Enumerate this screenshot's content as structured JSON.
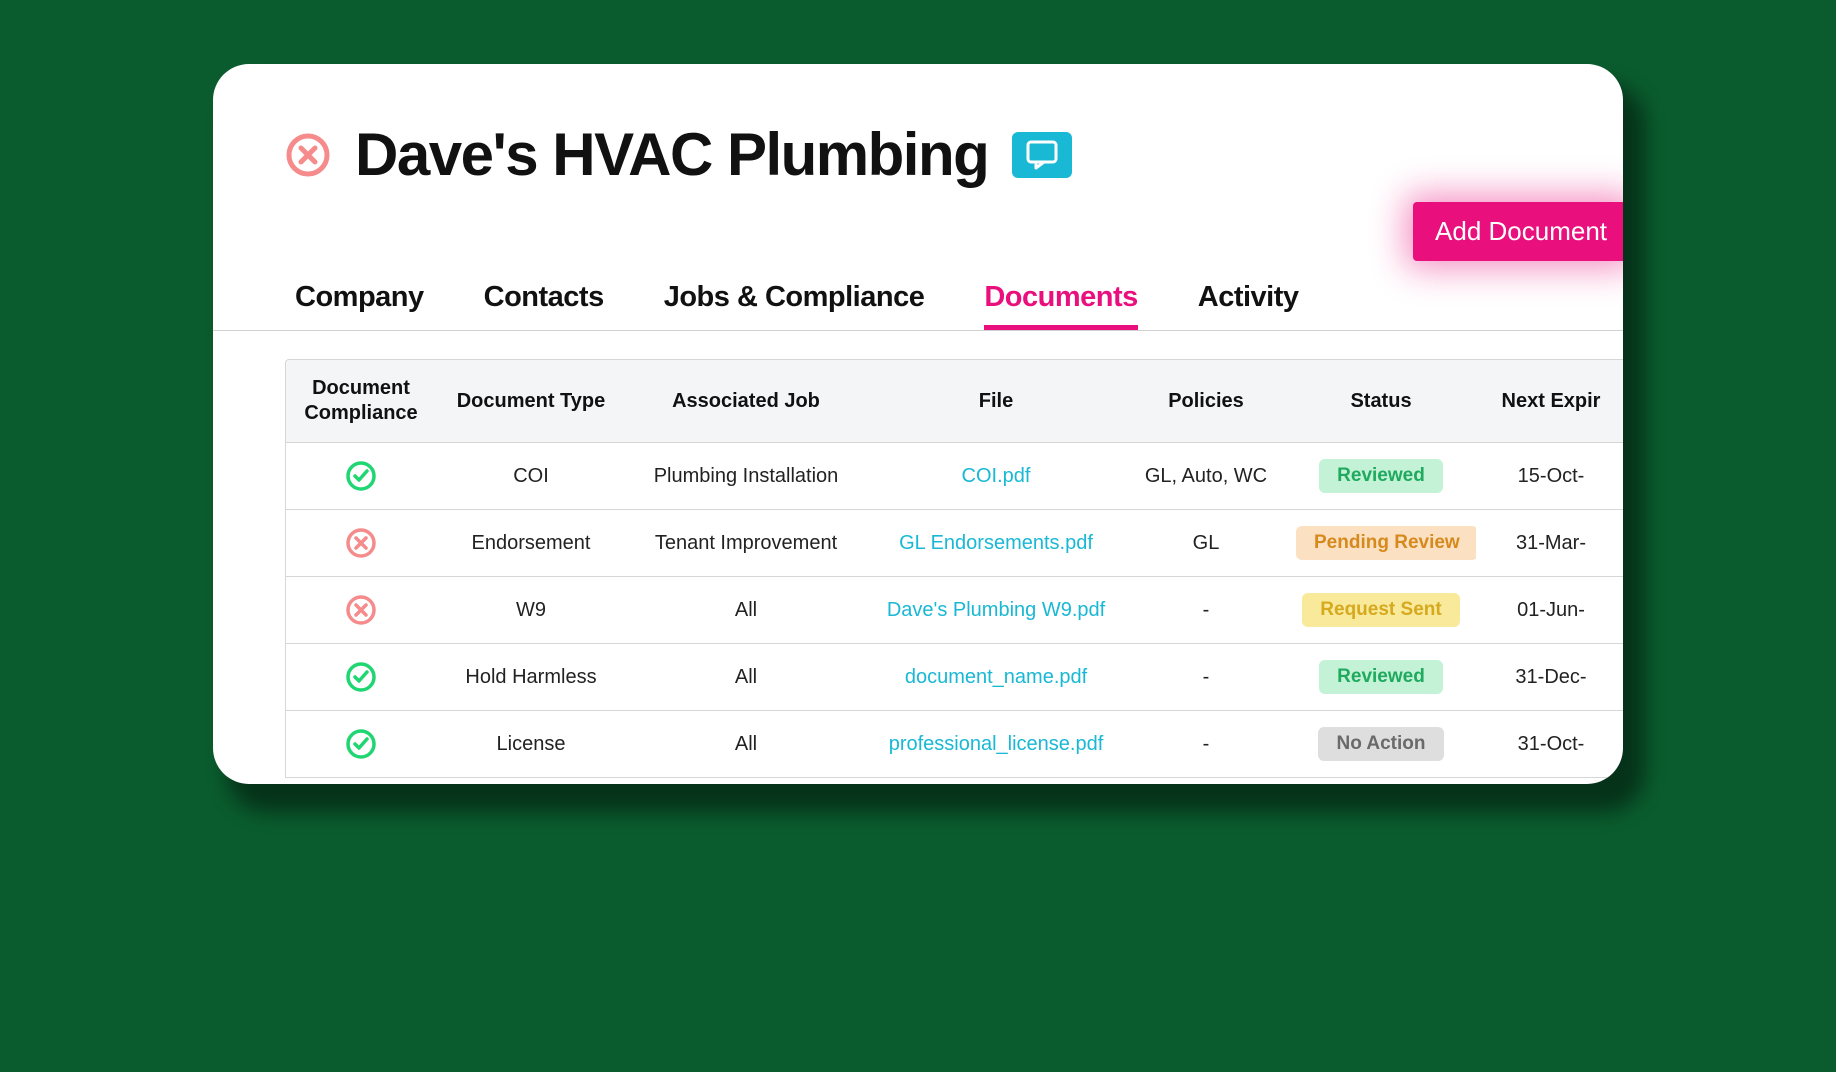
{
  "header": {
    "title": "Dave's HVAC Plumbing"
  },
  "actions": {
    "add_document_label": "Add Document"
  },
  "tabs": [
    {
      "label": "Company",
      "active": false
    },
    {
      "label": "Contacts",
      "active": false
    },
    {
      "label": "Jobs & Compliance",
      "active": false
    },
    {
      "label": "Documents",
      "active": true
    },
    {
      "label": "Activity",
      "active": false
    }
  ],
  "table": {
    "columns": [
      "Document Compliance",
      "Document Type",
      "Associated Job",
      "File",
      "Policies",
      "Status",
      "Next Expir"
    ],
    "rows": [
      {
        "compliant": true,
        "type": "COI",
        "job": "Plumbing Installation",
        "file": "COI.pdf",
        "policies": "GL, Auto, WC",
        "status": "Reviewed",
        "status_style": "reviewed",
        "expiry": "15-Oct-"
      },
      {
        "compliant": false,
        "type": "Endorsement",
        "job": "Tenant Improvement",
        "file": "GL Endorsements.pdf",
        "policies": "GL",
        "status": "Pending Review",
        "status_style": "pending",
        "expiry": "31-Mar-"
      },
      {
        "compliant": false,
        "type": "W9",
        "job": "All",
        "file": "Dave's Plumbing W9.pdf",
        "policies": "-",
        "status": "Request Sent",
        "status_style": "request",
        "expiry": "01-Jun-"
      },
      {
        "compliant": true,
        "type": "Hold Harmless",
        "job": "All",
        "file": "document_name.pdf",
        "policies": "-",
        "status": "Reviewed",
        "status_style": "reviewed",
        "expiry": "31-Dec-"
      },
      {
        "compliant": true,
        "type": "License",
        "job": "All",
        "file": "professional_license.pdf",
        "policies": "-",
        "status": "No Action",
        "status_style": "noaction",
        "expiry": "31-Oct-"
      }
    ]
  }
}
